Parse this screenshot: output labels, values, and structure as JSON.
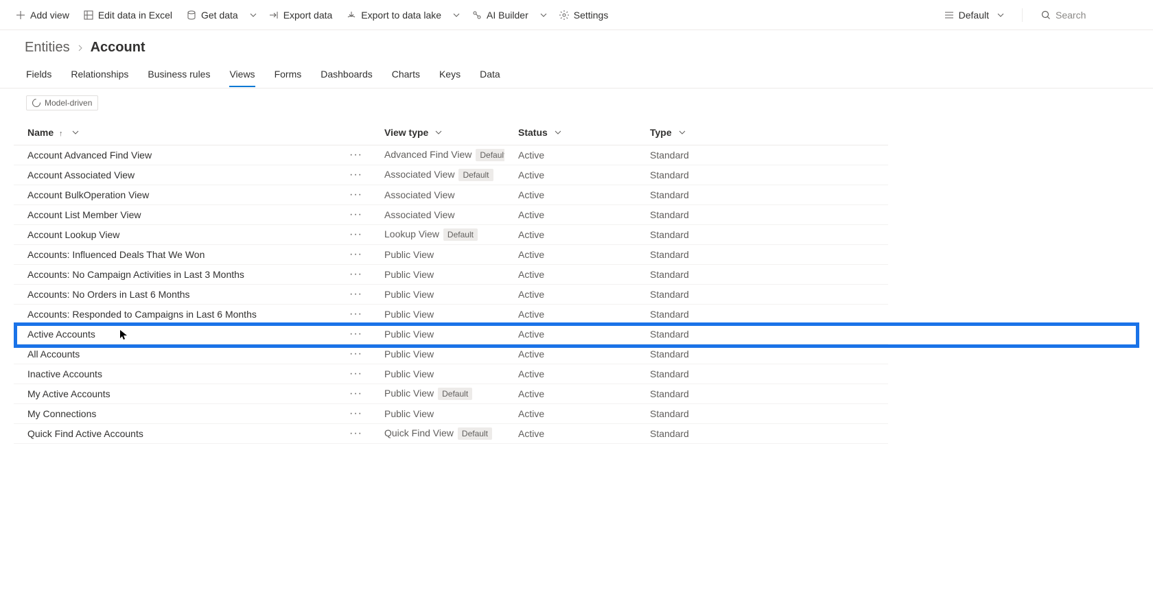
{
  "commandbar": {
    "add_view": "Add view",
    "edit_data": "Edit data in Excel",
    "get_data": "Get data",
    "export_data": "Export data",
    "export_lake": "Export to data lake",
    "ai_builder": "AI Builder",
    "settings": "Settings",
    "view_selector": "Default",
    "search_placeholder": "Search"
  },
  "breadcrumb": {
    "parent": "Entities",
    "current": "Account"
  },
  "tabs": [
    {
      "id": "fields",
      "label": "Fields",
      "active": false
    },
    {
      "id": "relationships",
      "label": "Relationships",
      "active": false
    },
    {
      "id": "business-rules",
      "label": "Business rules",
      "active": false
    },
    {
      "id": "views",
      "label": "Views",
      "active": true
    },
    {
      "id": "forms",
      "label": "Forms",
      "active": false
    },
    {
      "id": "dashboards",
      "label": "Dashboards",
      "active": false
    },
    {
      "id": "charts",
      "label": "Charts",
      "active": false
    },
    {
      "id": "keys",
      "label": "Keys",
      "active": false
    },
    {
      "id": "data",
      "label": "Data",
      "active": false
    }
  ],
  "pill": {
    "label": "Model-driven"
  },
  "columns": {
    "name": "Name",
    "view_type": "View type",
    "status": "Status",
    "type": "Type"
  },
  "default_badge": "Default",
  "rows": [
    {
      "name": "Account Advanced Find View",
      "view_type": "Advanced Find View",
      "is_default": true,
      "status": "Active",
      "type": "Standard",
      "highlighted": false
    },
    {
      "name": "Account Associated View",
      "view_type": "Associated View",
      "is_default": true,
      "status": "Active",
      "type": "Standard",
      "highlighted": false
    },
    {
      "name": "Account BulkOperation View",
      "view_type": "Associated View",
      "is_default": false,
      "status": "Active",
      "type": "Standard",
      "highlighted": false
    },
    {
      "name": "Account List Member View",
      "view_type": "Associated View",
      "is_default": false,
      "status": "Active",
      "type": "Standard",
      "highlighted": false
    },
    {
      "name": "Account Lookup View",
      "view_type": "Lookup View",
      "is_default": true,
      "status": "Active",
      "type": "Standard",
      "highlighted": false
    },
    {
      "name": "Accounts: Influenced Deals That We Won",
      "view_type": "Public View",
      "is_default": false,
      "status": "Active",
      "type": "Standard",
      "highlighted": false
    },
    {
      "name": "Accounts: No Campaign Activities in Last 3 Months",
      "view_type": "Public View",
      "is_default": false,
      "status": "Active",
      "type": "Standard",
      "highlighted": false
    },
    {
      "name": "Accounts: No Orders in Last 6 Months",
      "view_type": "Public View",
      "is_default": false,
      "status": "Active",
      "type": "Standard",
      "highlighted": false
    },
    {
      "name": "Accounts: Responded to Campaigns in Last 6 Months",
      "view_type": "Public View",
      "is_default": false,
      "status": "Active",
      "type": "Standard",
      "highlighted": false
    },
    {
      "name": "Active Accounts",
      "view_type": "Public View",
      "is_default": false,
      "status": "Active",
      "type": "Standard",
      "highlighted": true
    },
    {
      "name": "All Accounts",
      "view_type": "Public View",
      "is_default": false,
      "status": "Active",
      "type": "Standard",
      "highlighted": false
    },
    {
      "name": "Inactive Accounts",
      "view_type": "Public View",
      "is_default": false,
      "status": "Active",
      "type": "Standard",
      "highlighted": false
    },
    {
      "name": "My Active Accounts",
      "view_type": "Public View",
      "is_default": true,
      "status": "Active",
      "type": "Standard",
      "highlighted": false
    },
    {
      "name": "My Connections",
      "view_type": "Public View",
      "is_default": false,
      "status": "Active",
      "type": "Standard",
      "highlighted": false
    },
    {
      "name": "Quick Find Active Accounts",
      "view_type": "Quick Find View",
      "is_default": true,
      "status": "Active",
      "type": "Standard",
      "highlighted": false
    }
  ]
}
